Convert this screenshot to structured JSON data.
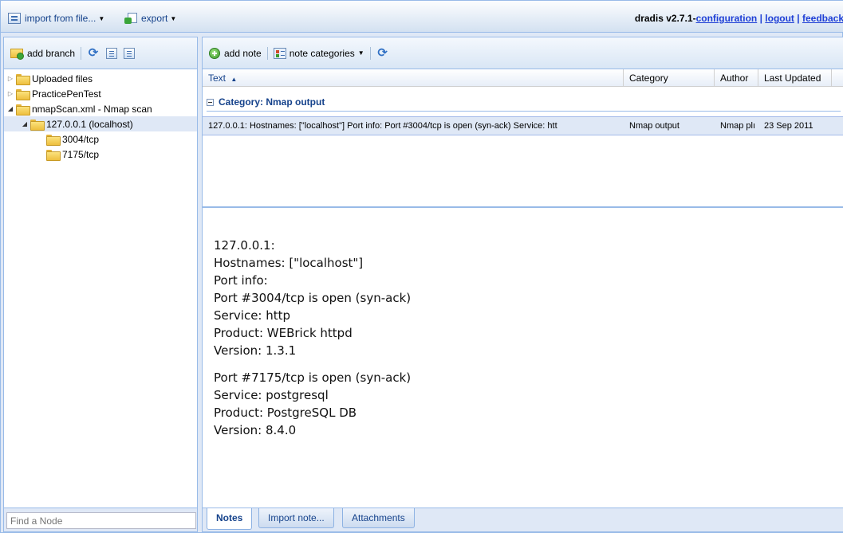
{
  "toolbar": {
    "import_label": "import from file...",
    "export_label": "export",
    "brand": "dradis v2.7.1-",
    "links": [
      "configuration",
      "logout",
      "feedback"
    ]
  },
  "left": {
    "add_branch_label": "add branch",
    "tree": [
      {
        "label": "Uploaded files",
        "expanded": false
      },
      {
        "label": "PracticePenTest",
        "expanded": false
      },
      {
        "label": "nmapScan.xml - Nmap scan",
        "expanded": true
      },
      {
        "label": "127.0.0.1 (localhost)",
        "expanded": true,
        "selected": true
      },
      {
        "label": "3004/tcp"
      },
      {
        "label": "7175/tcp"
      }
    ],
    "find_placeholder": "Find a Node"
  },
  "notes": {
    "add_note_label": "add note",
    "categories_label": "note categories",
    "columns": [
      "Text",
      "Category",
      "Author",
      "Last Updated"
    ],
    "sort_indicator": "▲",
    "group_label": "Category: Nmap output",
    "row": {
      "text": "127.0.0.1: Hostnames: [\"localhost\"] Port info: Port #3004/tcp is open (syn-ack) Service: htt",
      "category": "Nmap output",
      "author": "Nmap plı",
      "updated": "23 Sep 2011"
    },
    "content": [
      "127.0.0.1:",
      "Hostnames: [\"localhost\"]",
      "Port info:",
      "Port #3004/tcp is open (syn-ack)",
      "Service: http",
      "Product: WEBrick httpd",
      "Version: 1.3.1",
      "",
      "Port #7175/tcp is open (syn-ack)",
      "Service: postgresql",
      "Product: PostgreSQL DB",
      "Version: 8.4.0"
    ],
    "tabs": [
      "Notes",
      "Import note...",
      "Attachments"
    ]
  },
  "colors": {
    "panel_border": "#99bbe8",
    "header_text": "#15428b",
    "link": "#1e3fd6",
    "selection": "#dfe8f6"
  }
}
